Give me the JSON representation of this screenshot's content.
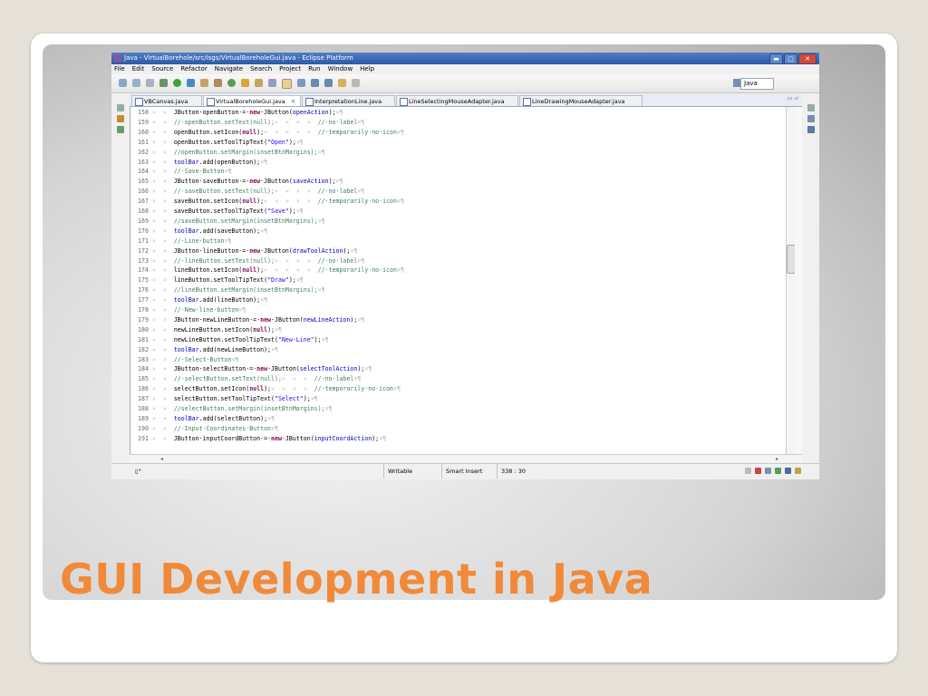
{
  "slide": {
    "title": "GUI Development in Java"
  },
  "window": {
    "title": "Java - VirtualBorehole/src/isgs/VirtualBoreholeGui.java - Eclipse Platform",
    "controls": {
      "minimize": "▬",
      "maximize": "▢",
      "close": "✕"
    }
  },
  "menu": [
    "File",
    "Edit",
    "Source",
    "Refactor",
    "Navigate",
    "Search",
    "Project",
    "Run",
    "Window",
    "Help"
  ],
  "perspective": {
    "label": "Java"
  },
  "tabs": [
    {
      "label": "VBCanvas.java",
      "active": false
    },
    {
      "label": "VirtualBoreholeGui.java",
      "active": true
    },
    {
      "label": "InterpretationLine.java",
      "active": false
    },
    {
      "label": "LineSelectingMouseAdapter.java",
      "active": false
    },
    {
      "label": "LineDrawingMouseAdapter.java",
      "active": false
    }
  ],
  "editor": {
    "lines": [
      {
        "n": "158",
        "t": [
          [
            "s",
            "»  »  "
          ],
          [
            "p",
            "JButton·openButton·=·"
          ],
          [
            "k",
            "new"
          ],
          [
            "p",
            "·JButton("
          ],
          [
            "f",
            "openAction"
          ],
          [
            "p",
            ");"
          ],
          [
            "s",
            "¤¶"
          ]
        ]
      },
      {
        "n": "159",
        "t": [
          [
            "s",
            "»  »  "
          ],
          [
            "c",
            "//·openButton.setText(null);"
          ],
          [
            "s",
            "»  »  »  »  "
          ],
          [
            "c",
            "//·no·label"
          ],
          [
            "s",
            "¤¶"
          ]
        ]
      },
      {
        "n": "160",
        "t": [
          [
            "s",
            "»  »  "
          ],
          [
            "p",
            "openButton.setIcon("
          ],
          [
            "k",
            "null"
          ],
          [
            "p",
            ");"
          ],
          [
            "s",
            "»  »  »  »  »  "
          ],
          [
            "c",
            "//·temporarily·no·icon"
          ],
          [
            "s",
            "¤¶"
          ]
        ]
      },
      {
        "n": "161",
        "t": [
          [
            "s",
            "»  »  "
          ],
          [
            "p",
            "openButton.setToolTipText("
          ],
          [
            "r",
            "\"Open\""
          ],
          [
            "p",
            ");"
          ],
          [
            "s",
            "¤¶"
          ]
        ]
      },
      {
        "n": "162",
        "t": [
          [
            "s",
            "»  »  "
          ],
          [
            "c",
            "//openButton.setMargin(insetBtnMargins);"
          ],
          [
            "s",
            "¤¶"
          ]
        ]
      },
      {
        "n": "163",
        "t": [
          [
            "s",
            "»  »  "
          ],
          [
            "f",
            "toolBar"
          ],
          [
            "p",
            ".add(openButton);"
          ],
          [
            "s",
            "¤¶"
          ]
        ]
      },
      {
        "n": "164",
        "t": [
          [
            "s",
            "»  »  "
          ],
          [
            "c",
            "//·Save·Button"
          ],
          [
            "s",
            "¤¶"
          ]
        ]
      },
      {
        "n": "165",
        "t": [
          [
            "s",
            "»  »  "
          ],
          [
            "p",
            "JButton·saveButton·=·"
          ],
          [
            "k",
            "new"
          ],
          [
            "p",
            "·JButton("
          ],
          [
            "f",
            "saveAction"
          ],
          [
            "p",
            ");"
          ],
          [
            "s",
            "¤¶"
          ]
        ]
      },
      {
        "n": "166",
        "t": [
          [
            "s",
            "»  »  "
          ],
          [
            "c",
            "//·saveButton.setText(null);"
          ],
          [
            "s",
            "»  »  »  »  "
          ],
          [
            "c",
            "//·no·label"
          ],
          [
            "s",
            "¤¶"
          ]
        ]
      },
      {
        "n": "167",
        "t": [
          [
            "s",
            "»  »  "
          ],
          [
            "p",
            "saveButton.setIcon("
          ],
          [
            "k",
            "null"
          ],
          [
            "p",
            ");"
          ],
          [
            "s",
            "»  »  »  »  »  "
          ],
          [
            "c",
            "//·temporarily·no·icon"
          ],
          [
            "s",
            "¤¶"
          ]
        ]
      },
      {
        "n": "168",
        "t": [
          [
            "s",
            "»  »  "
          ],
          [
            "p",
            "saveButton.setToolTipText("
          ],
          [
            "r",
            "\"Save\""
          ],
          [
            "p",
            ");"
          ],
          [
            "s",
            "¤¶"
          ]
        ]
      },
      {
        "n": "169",
        "t": [
          [
            "s",
            "»  »  "
          ],
          [
            "c",
            "//saveButton.setMargin(insetBtnMargins);"
          ],
          [
            "s",
            "¤¶"
          ]
        ]
      },
      {
        "n": "170",
        "t": [
          [
            "s",
            "»  »  "
          ],
          [
            "f",
            "toolBar"
          ],
          [
            "p",
            ".add(saveButton);"
          ],
          [
            "s",
            "¤¶"
          ]
        ]
      },
      {
        "n": "171",
        "t": [
          [
            "s",
            "»  »  "
          ],
          [
            "c",
            "//·Line·button"
          ],
          [
            "s",
            "¤¶"
          ]
        ]
      },
      {
        "n": "172",
        "t": [
          [
            "s",
            "»  »  "
          ],
          [
            "p",
            "JButton·lineButton·=·"
          ],
          [
            "k",
            "new"
          ],
          [
            "p",
            "·JButton("
          ],
          [
            "f",
            "drawToolAction"
          ],
          [
            "p",
            ");"
          ],
          [
            "s",
            "¤¶"
          ]
        ]
      },
      {
        "n": "173",
        "t": [
          [
            "s",
            "»  »  "
          ],
          [
            "c",
            "//·lineButton.setText(null);"
          ],
          [
            "s",
            "»  »  »  »  "
          ],
          [
            "c",
            "//·no·label"
          ],
          [
            "s",
            "¤¶"
          ]
        ]
      },
      {
        "n": "174",
        "t": [
          [
            "s",
            "»  »  "
          ],
          [
            "p",
            "lineButton.setIcon("
          ],
          [
            "k",
            "null"
          ],
          [
            "p",
            ");"
          ],
          [
            "s",
            "»  »  »  »  »  "
          ],
          [
            "c",
            "//·temporarily·no·icon"
          ],
          [
            "s",
            "¤¶"
          ]
        ]
      },
      {
        "n": "175",
        "t": [
          [
            "s",
            "»  »  "
          ],
          [
            "p",
            "lineButton.setToolTipText("
          ],
          [
            "r",
            "\"Draw\""
          ],
          [
            "p",
            ");"
          ],
          [
            "s",
            "¤¶"
          ]
        ]
      },
      {
        "n": "176",
        "t": [
          [
            "s",
            "»  »  "
          ],
          [
            "c",
            "//lineButton.setMargin(insetBtnMargins);"
          ],
          [
            "s",
            "¤¶"
          ]
        ]
      },
      {
        "n": "177",
        "t": [
          [
            "s",
            "»  »  "
          ],
          [
            "f",
            "toolBar"
          ],
          [
            "p",
            ".add(lineButton);"
          ],
          [
            "s",
            "¤¶"
          ]
        ]
      },
      {
        "n": "178",
        "t": [
          [
            "s",
            "»  »  "
          ],
          [
            "c",
            "//·New·line·button"
          ],
          [
            "s",
            "¤¶"
          ]
        ]
      },
      {
        "n": "179",
        "t": [
          [
            "s",
            "»  »  "
          ],
          [
            "p",
            "JButton·newLineButton·=·"
          ],
          [
            "k",
            "new"
          ],
          [
            "p",
            "·JButton("
          ],
          [
            "f",
            "newLineAction"
          ],
          [
            "p",
            ");"
          ],
          [
            "s",
            "¤¶"
          ]
        ]
      },
      {
        "n": "180",
        "t": [
          [
            "s",
            "»  »  "
          ],
          [
            "p",
            "newLineButton.setIcon("
          ],
          [
            "k",
            "null"
          ],
          [
            "p",
            ");"
          ],
          [
            "s",
            "¤¶"
          ]
        ]
      },
      {
        "n": "181",
        "t": [
          [
            "s",
            "»  »  "
          ],
          [
            "p",
            "newLineButton.setToolTipText("
          ],
          [
            "r",
            "\"New·Line\""
          ],
          [
            "p",
            ");"
          ],
          [
            "s",
            "¤¶"
          ]
        ]
      },
      {
        "n": "182",
        "t": [
          [
            "s",
            "»  »  "
          ],
          [
            "f",
            "toolBar"
          ],
          [
            "p",
            ".add(newLineButton);"
          ],
          [
            "s",
            "¤¶"
          ]
        ]
      },
      {
        "n": "183",
        "t": [
          [
            "s",
            "»  »  "
          ],
          [
            "c",
            "//·Select·Button"
          ],
          [
            "s",
            "¤¶"
          ]
        ]
      },
      {
        "n": "184",
        "t": [
          [
            "s",
            "»  »  "
          ],
          [
            "p",
            "JButton·selectButton·=·"
          ],
          [
            "k",
            "new"
          ],
          [
            "p",
            "·JButton("
          ],
          [
            "f",
            "selectToolAction"
          ],
          [
            "p",
            ");"
          ],
          [
            "s",
            "¤¶"
          ]
        ]
      },
      {
        "n": "185",
        "t": [
          [
            "s",
            "»  »  "
          ],
          [
            "c",
            "//·selectButton.setText(null);"
          ],
          [
            "s",
            "»  »  »  "
          ],
          [
            "c",
            "//·no·label"
          ],
          [
            "s",
            "¤¶"
          ]
        ]
      },
      {
        "n": "186",
        "t": [
          [
            "s",
            "»  »  "
          ],
          [
            "p",
            "selectButton.setIcon("
          ],
          [
            "k",
            "null"
          ],
          [
            "p",
            ");"
          ],
          [
            "s",
            "»  »  »  »  "
          ],
          [
            "c",
            "//·temporarily·no·icon"
          ],
          [
            "s",
            "¤¶"
          ]
        ]
      },
      {
        "n": "187",
        "t": [
          [
            "s",
            "»  »  "
          ],
          [
            "p",
            "selectButton.setToolTipText("
          ],
          [
            "r",
            "\"Select\""
          ],
          [
            "p",
            ");"
          ],
          [
            "s",
            "¤¶"
          ]
        ]
      },
      {
        "n": "188",
        "t": [
          [
            "s",
            "»  »  "
          ],
          [
            "c",
            "//selectButton.setMargin(insetBtnMargins);"
          ],
          [
            "s",
            "¤¶"
          ]
        ]
      },
      {
        "n": "189",
        "t": [
          [
            "s",
            "»  »  "
          ],
          [
            "f",
            "toolBar"
          ],
          [
            "p",
            ".add(selectButton);"
          ],
          [
            "s",
            "¤¶"
          ]
        ]
      },
      {
        "n": "190",
        "t": [
          [
            "s",
            "»  »  "
          ],
          [
            "c",
            "//·Input·Coordinates·Button"
          ],
          [
            "s",
            "¤¶"
          ]
        ]
      },
      {
        "n": "191",
        "t": [
          [
            "s",
            "»  »  "
          ],
          [
            "p",
            "JButton·inputCoordButton·=·"
          ],
          [
            "k",
            "new"
          ],
          [
            "p",
            "·JButton("
          ],
          [
            "f",
            "inputCoordAction"
          ],
          [
            "p",
            ");"
          ],
          [
            "s",
            "¤¶"
          ]
        ]
      }
    ]
  },
  "status": {
    "writable": "Writable",
    "insert_mode": "Smart Insert",
    "position": "338 : 30"
  },
  "colors": {
    "keyword": "#7f0055",
    "string": "#2a00ff",
    "comment": "#3f7f5f",
    "field": "#0000c0",
    "title_orange": "#f08a3a"
  }
}
